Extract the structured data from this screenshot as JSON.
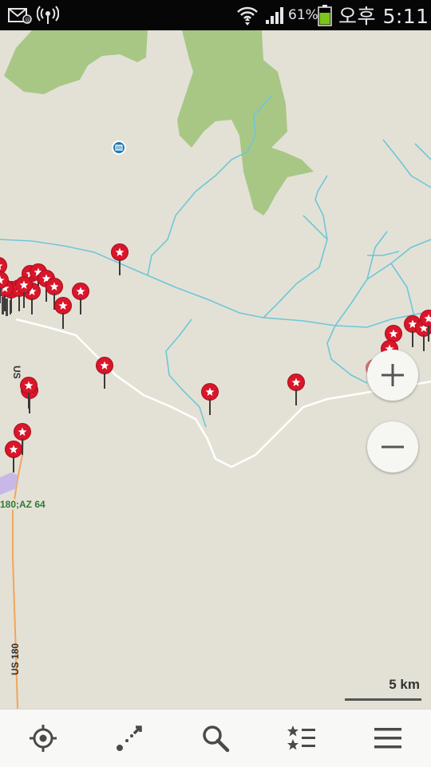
{
  "status_bar": {
    "battery_percent": "61%",
    "time": "오후 5:11",
    "icons": [
      "mail-notification-icon",
      "broadcast-icon",
      "wifi-icon",
      "signal-icon",
      "battery-icon"
    ]
  },
  "map": {
    "road_labels": {
      "us_180_vertical_top": "US",
      "us_180_vertical_bottom": "US 180",
      "route_label": "180;AZ 64"
    },
    "scale_label": "5 km",
    "poi_icon": "lodging-poi-icon",
    "marker_icon": "star-marker-icon",
    "colors": {
      "land": "#e3e1d6",
      "forest": "#a8c785",
      "water": "#6fc6d8",
      "road": "#ffffff",
      "highway": "#f2a65a",
      "marker": "#d9162a"
    }
  },
  "zoom": {
    "in_label": "+",
    "out_label": "−"
  },
  "bottom_nav": [
    {
      "name": "my-location",
      "icon": "crosshair-icon"
    },
    {
      "name": "directions",
      "icon": "route-icon"
    },
    {
      "name": "search",
      "icon": "search-icon"
    },
    {
      "name": "bookmarks",
      "icon": "star-list-icon"
    },
    {
      "name": "menu",
      "icon": "menu-icon"
    }
  ]
}
